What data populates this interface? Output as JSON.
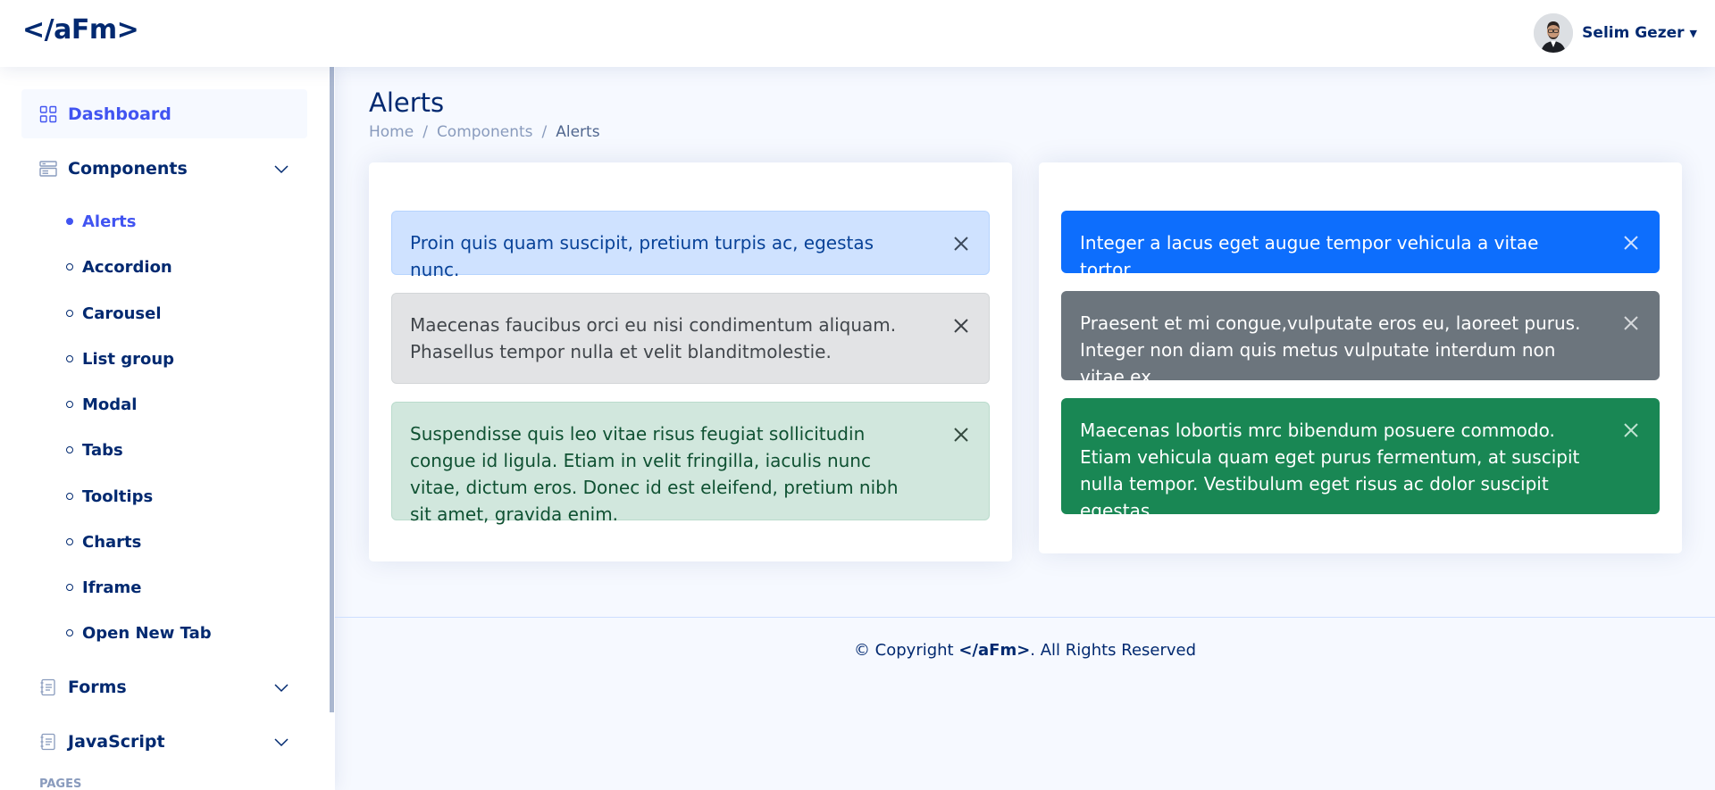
{
  "header": {
    "logo": "</aFm>",
    "user_name": "Selim Gezer"
  },
  "sidebar": {
    "items": [
      {
        "label": "Dashboard"
      },
      {
        "label": "Components"
      },
      {
        "label": "Forms"
      },
      {
        "label": "JavaScript"
      }
    ],
    "components_sub": [
      {
        "label": "Alerts"
      },
      {
        "label": "Accordion"
      },
      {
        "label": "Carousel"
      },
      {
        "label": "List group"
      },
      {
        "label": "Modal"
      },
      {
        "label": "Tabs"
      },
      {
        "label": "Tooltips"
      },
      {
        "label": "Charts"
      },
      {
        "label": "Iframe"
      },
      {
        "label": "Open New Tab"
      }
    ],
    "heading_pages": "PAGES"
  },
  "page": {
    "title": "Alerts",
    "breadcrumb": [
      "Home",
      "Components",
      "Alerts"
    ],
    "separator": "/"
  },
  "alerts_left": [
    {
      "text": "Proin quis quam suscipit, pretium turpis ac, egestas nunc."
    },
    {
      "text": "Maecenas faucibus orci eu nisi condimentum aliquam. Phasellus tempor nulla et velit blanditmolestie."
    },
    {
      "text": "Suspendisse quis leo vitae risus feugiat sollicitudin congue id ligula. Etiam in velit fringilla, iaculis nunc vitae, dictum eros. Donec id est eleifend, pretium nibh sit amet, gravida enim."
    }
  ],
  "alerts_right": [
    {
      "text": "Integer a lacus eget augue tempor vehicula a vitae tortor."
    },
    {
      "text": "Praesent et mi congue,vulputate eros eu, laoreet purus. Integer non diam quis metus vulputate interdum non vitae ex."
    },
    {
      "text": "Maecenas lobortis mrc bibendum posuere commodo. Etiam vehicula quam eget purus fermentum, at suscipit nulla tempor. Vestibulum eget risus ac dolor suscipit egestas."
    }
  ],
  "footer": {
    "prefix": "© Copyright ",
    "brand": "</aFm>",
    "suffix": ". All Rights Reserved"
  },
  "colors": {
    "brand": "#012970",
    "accent": "#4154f1",
    "primary": "#0d6efd",
    "secondary": "#6c757d",
    "success": "#198754"
  },
  "icons": {
    "dashboard": "grid-icon",
    "components": "menu-button-icon",
    "forms": "journal-text-icon",
    "javascript": "journal-text-icon",
    "close": "close-icon",
    "chevron": "chevron-down-icon"
  }
}
